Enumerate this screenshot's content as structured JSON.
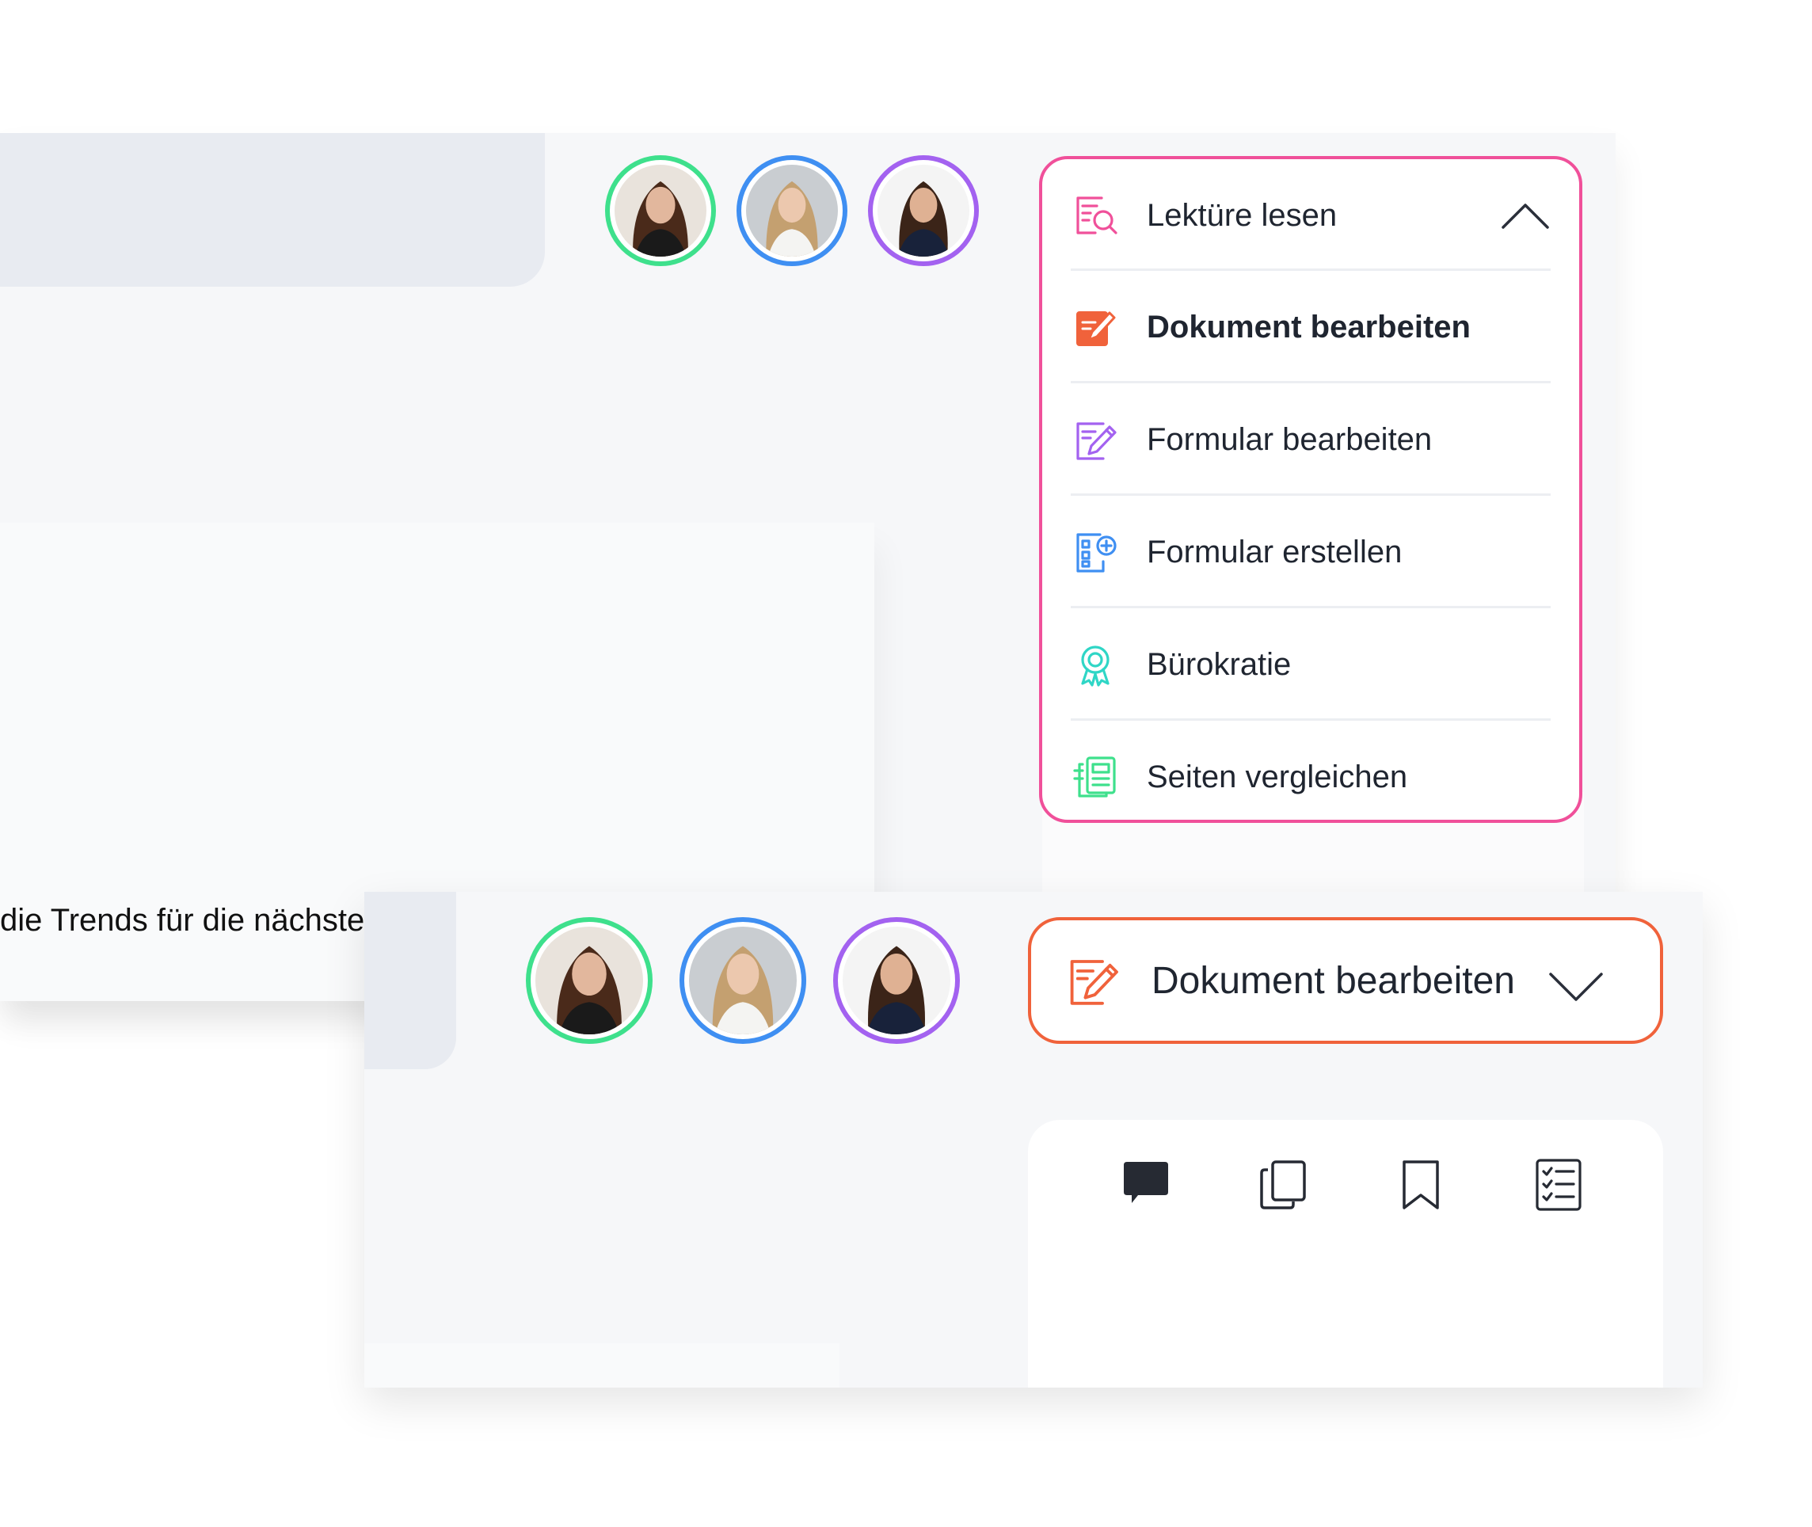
{
  "back": {
    "trend_text": "die Trends für die nächste",
    "avatars": [
      {
        "name": "avatar-1",
        "ring": "#3ee08c"
      },
      {
        "name": "avatar-2",
        "ring": "#3f8ff2"
      },
      {
        "name": "avatar-3",
        "ring": "#a362f0"
      }
    ],
    "dropdown": {
      "border_color": "#f0509a",
      "selected_label": "Lektüre lesen",
      "items": [
        {
          "label": "Dokument bearbeiten",
          "icon": "document-edit-icon",
          "color": "#f0623b"
        },
        {
          "label": "Formular bearbeiten",
          "icon": "form-edit-icon",
          "color": "#a362f0"
        },
        {
          "label": "Formular erstellen",
          "icon": "form-create-icon",
          "color": "#3f8ff2"
        },
        {
          "label": "Bürokratie",
          "icon": "badge-icon",
          "color": "#2fd6c6"
        },
        {
          "label": "Seiten vergleichen",
          "icon": "compare-pages-icon",
          "color": "#3ee08c"
        }
      ],
      "selected_icon": "reading-search-icon",
      "selected_icon_color": "#f0509a"
    }
  },
  "front": {
    "avatars": [
      {
        "name": "avatar-1",
        "ring": "#3ee08c"
      },
      {
        "name": "avatar-2",
        "ring": "#3f8ff2"
      },
      {
        "name": "avatar-3",
        "ring": "#a362f0"
      }
    ],
    "select": {
      "label": "Dokument bearbeiten",
      "icon": "document-edit-icon",
      "border_color": "#f0623b"
    },
    "toolbar": [
      {
        "icon": "comment-icon"
      },
      {
        "icon": "copy-icon"
      },
      {
        "icon": "bookmark-icon"
      },
      {
        "icon": "checklist-icon"
      }
    ]
  }
}
